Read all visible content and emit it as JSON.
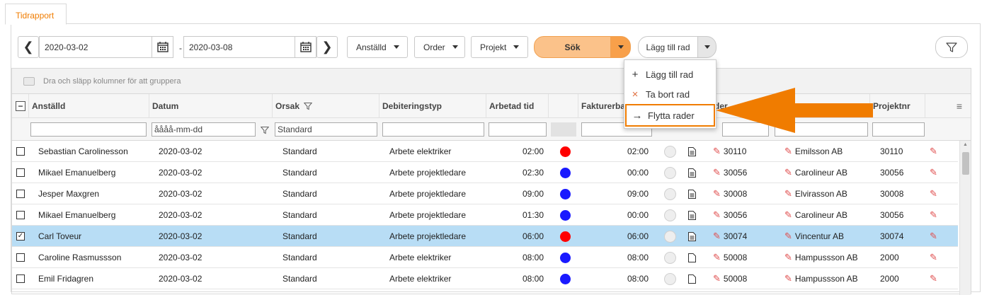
{
  "tab": {
    "label": "Tidrapport"
  },
  "toolbar": {
    "date_from": "2020-03-02",
    "date_sep": "-",
    "date_to": "2020-03-08",
    "employee_label": "Anställd",
    "order_label": "Order",
    "project_label": "Projekt",
    "search_label": "Sök",
    "add_row_label": "Lägg till rad"
  },
  "grid": {
    "group_hint": "Dra och släpp kolumner för att gruppera",
    "columns": {
      "employee": "Anställd",
      "date": "Datum",
      "reason": "Orsak",
      "debit_type": "Debiteringstyp",
      "worked_time": "Arbetad tid",
      "invoiced": "Fakturerbar",
      "order": "der",
      "project_no": "Projektnr"
    },
    "filters": {
      "date_placeholder": "åååå-mm-dd",
      "reason_value": "Standard"
    },
    "rows": [
      {
        "employee": "Sebastian Carolinesson",
        "date": "2020-03-02",
        "reason": "Standard",
        "debit": "Arbete elektriker",
        "worked": "02:00",
        "status": "red",
        "invoiced": "02:00",
        "doc": "doc-lines",
        "order": "30110",
        "customer": "Emilsson AB",
        "project": "30110",
        "checked": false,
        "selected": false
      },
      {
        "employee": "Mikael Emanuelberg",
        "date": "2020-03-02",
        "reason": "Standard",
        "debit": "Arbete projektledare",
        "worked": "02:30",
        "status": "blue",
        "invoiced": "00:00",
        "doc": "doc-lines",
        "order": "30056",
        "customer": "Carolineur AB",
        "project": "30056",
        "checked": false,
        "selected": false
      },
      {
        "employee": "Jesper Maxgren",
        "date": "2020-03-02",
        "reason": "Standard",
        "debit": "Arbete projektledare",
        "worked": "09:00",
        "status": "blue",
        "invoiced": "09:00",
        "doc": "doc-lines",
        "order": "30008",
        "customer": "Elvirasson AB",
        "project": "30008",
        "checked": false,
        "selected": false
      },
      {
        "employee": "Mikael Emanuelberg",
        "date": "2020-03-02",
        "reason": "Standard",
        "debit": "Arbete projektledare",
        "worked": "01:30",
        "status": "blue",
        "invoiced": "00:00",
        "doc": "doc-lines",
        "order": "30056",
        "customer": "Carolineur AB",
        "project": "30056",
        "checked": false,
        "selected": false
      },
      {
        "employee": "Carl Toveur",
        "date": "2020-03-02",
        "reason": "Standard",
        "debit": "Arbete projektledare",
        "worked": "06:00",
        "status": "red",
        "invoiced": "06:00",
        "doc": "doc-lines",
        "order": "30074",
        "customer": "Vincentur AB",
        "project": "30074",
        "checked": true,
        "selected": true
      },
      {
        "employee": "Caroline Rasmussson",
        "date": "2020-03-02",
        "reason": "Standard",
        "debit": "Arbete elektriker",
        "worked": "08:00",
        "status": "blue",
        "invoiced": "08:00",
        "doc": "doc-blank",
        "order": "50008",
        "customer": "Hampussson AB",
        "project": "2000",
        "checked": false,
        "selected": false
      },
      {
        "employee": "Emil Fridagren",
        "date": "2020-03-02",
        "reason": "Standard",
        "debit": "Arbete elektriker",
        "worked": "08:00",
        "status": "blue",
        "invoiced": "08:00",
        "doc": "doc-blank",
        "order": "50008",
        "customer": "Hampussson AB",
        "project": "2000",
        "checked": false,
        "selected": false
      }
    ]
  },
  "menu": {
    "items": [
      {
        "icon": "+",
        "label": "Lägg till rad"
      },
      {
        "icon": "×",
        "label": "Ta bort rad"
      },
      {
        "icon": "→",
        "label": "Flytta rader"
      }
    ]
  },
  "colors": {
    "accent": "#f07c00",
    "red": "#ff0000",
    "blue": "#1a1aff",
    "selected_row": "#b8ddf5"
  }
}
